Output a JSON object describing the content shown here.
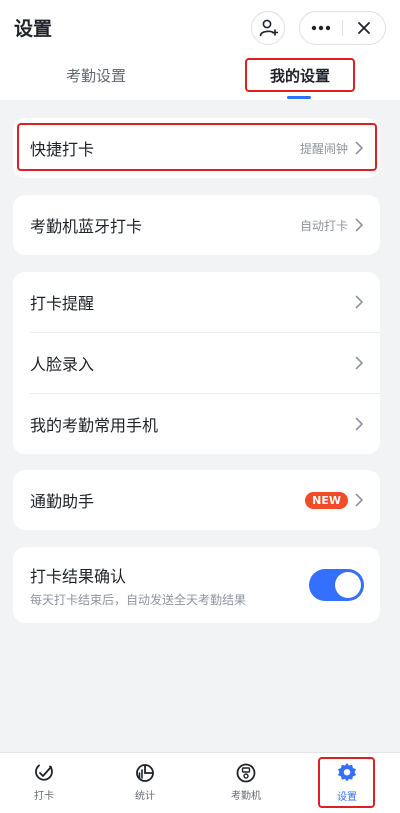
{
  "header": {
    "title": "设置",
    "icons": {
      "add_contact": "person-add-icon",
      "more": "more-dots-icon",
      "close": "close-icon"
    }
  },
  "tabs": [
    {
      "label": "考勤设置",
      "active": false
    },
    {
      "label": "我的设置",
      "active": true
    }
  ],
  "cards": {
    "quick_checkin": {
      "label": "快捷打卡",
      "hint": "提醒闹钟"
    },
    "bluetooth": {
      "label": "考勤机蓝牙打卡",
      "hint": "自动打卡"
    },
    "group": [
      {
        "label": "打卡提醒"
      },
      {
        "label": "人脸录入"
      },
      {
        "label": "我的考勤常用手机"
      }
    ],
    "commute": {
      "label": "通勤助手",
      "badge": "NEW"
    },
    "confirm": {
      "label": "打卡结果确认",
      "sub": "每天打卡结束后，自动发送全天考勤结果",
      "enabled": true
    }
  },
  "bottom_nav": [
    {
      "label": "打卡",
      "icon": "checkin-icon",
      "active": false
    },
    {
      "label": "统计",
      "icon": "stats-pie-icon",
      "active": false
    },
    {
      "label": "考勤机",
      "icon": "attendance-machine-icon",
      "active": false
    },
    {
      "label": "设置",
      "icon": "gear-icon",
      "active": true
    }
  ],
  "colors": {
    "accent": "#3370ff",
    "highlight": "#e02020",
    "badge": "#f54a2a"
  }
}
